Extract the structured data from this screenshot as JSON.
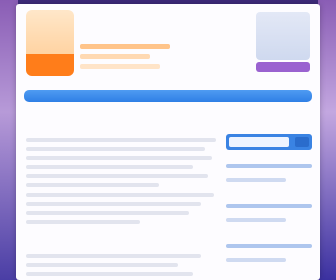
{
  "header": {
    "site_title": "",
    "site_tagline": "",
    "action_button_label": ""
  },
  "nav": {
    "items": [
      "",
      "",
      "",
      "",
      "",
      ""
    ]
  },
  "main": {
    "title": "",
    "subheading": ""
  },
  "sidebar": {
    "search_placeholder": ""
  },
  "colors": {
    "accent_orange": "#ff7d1a",
    "nav_blue": "#2f7fe6",
    "button_purple": "#9a62d0",
    "background_purple": "#5a3f9c"
  }
}
